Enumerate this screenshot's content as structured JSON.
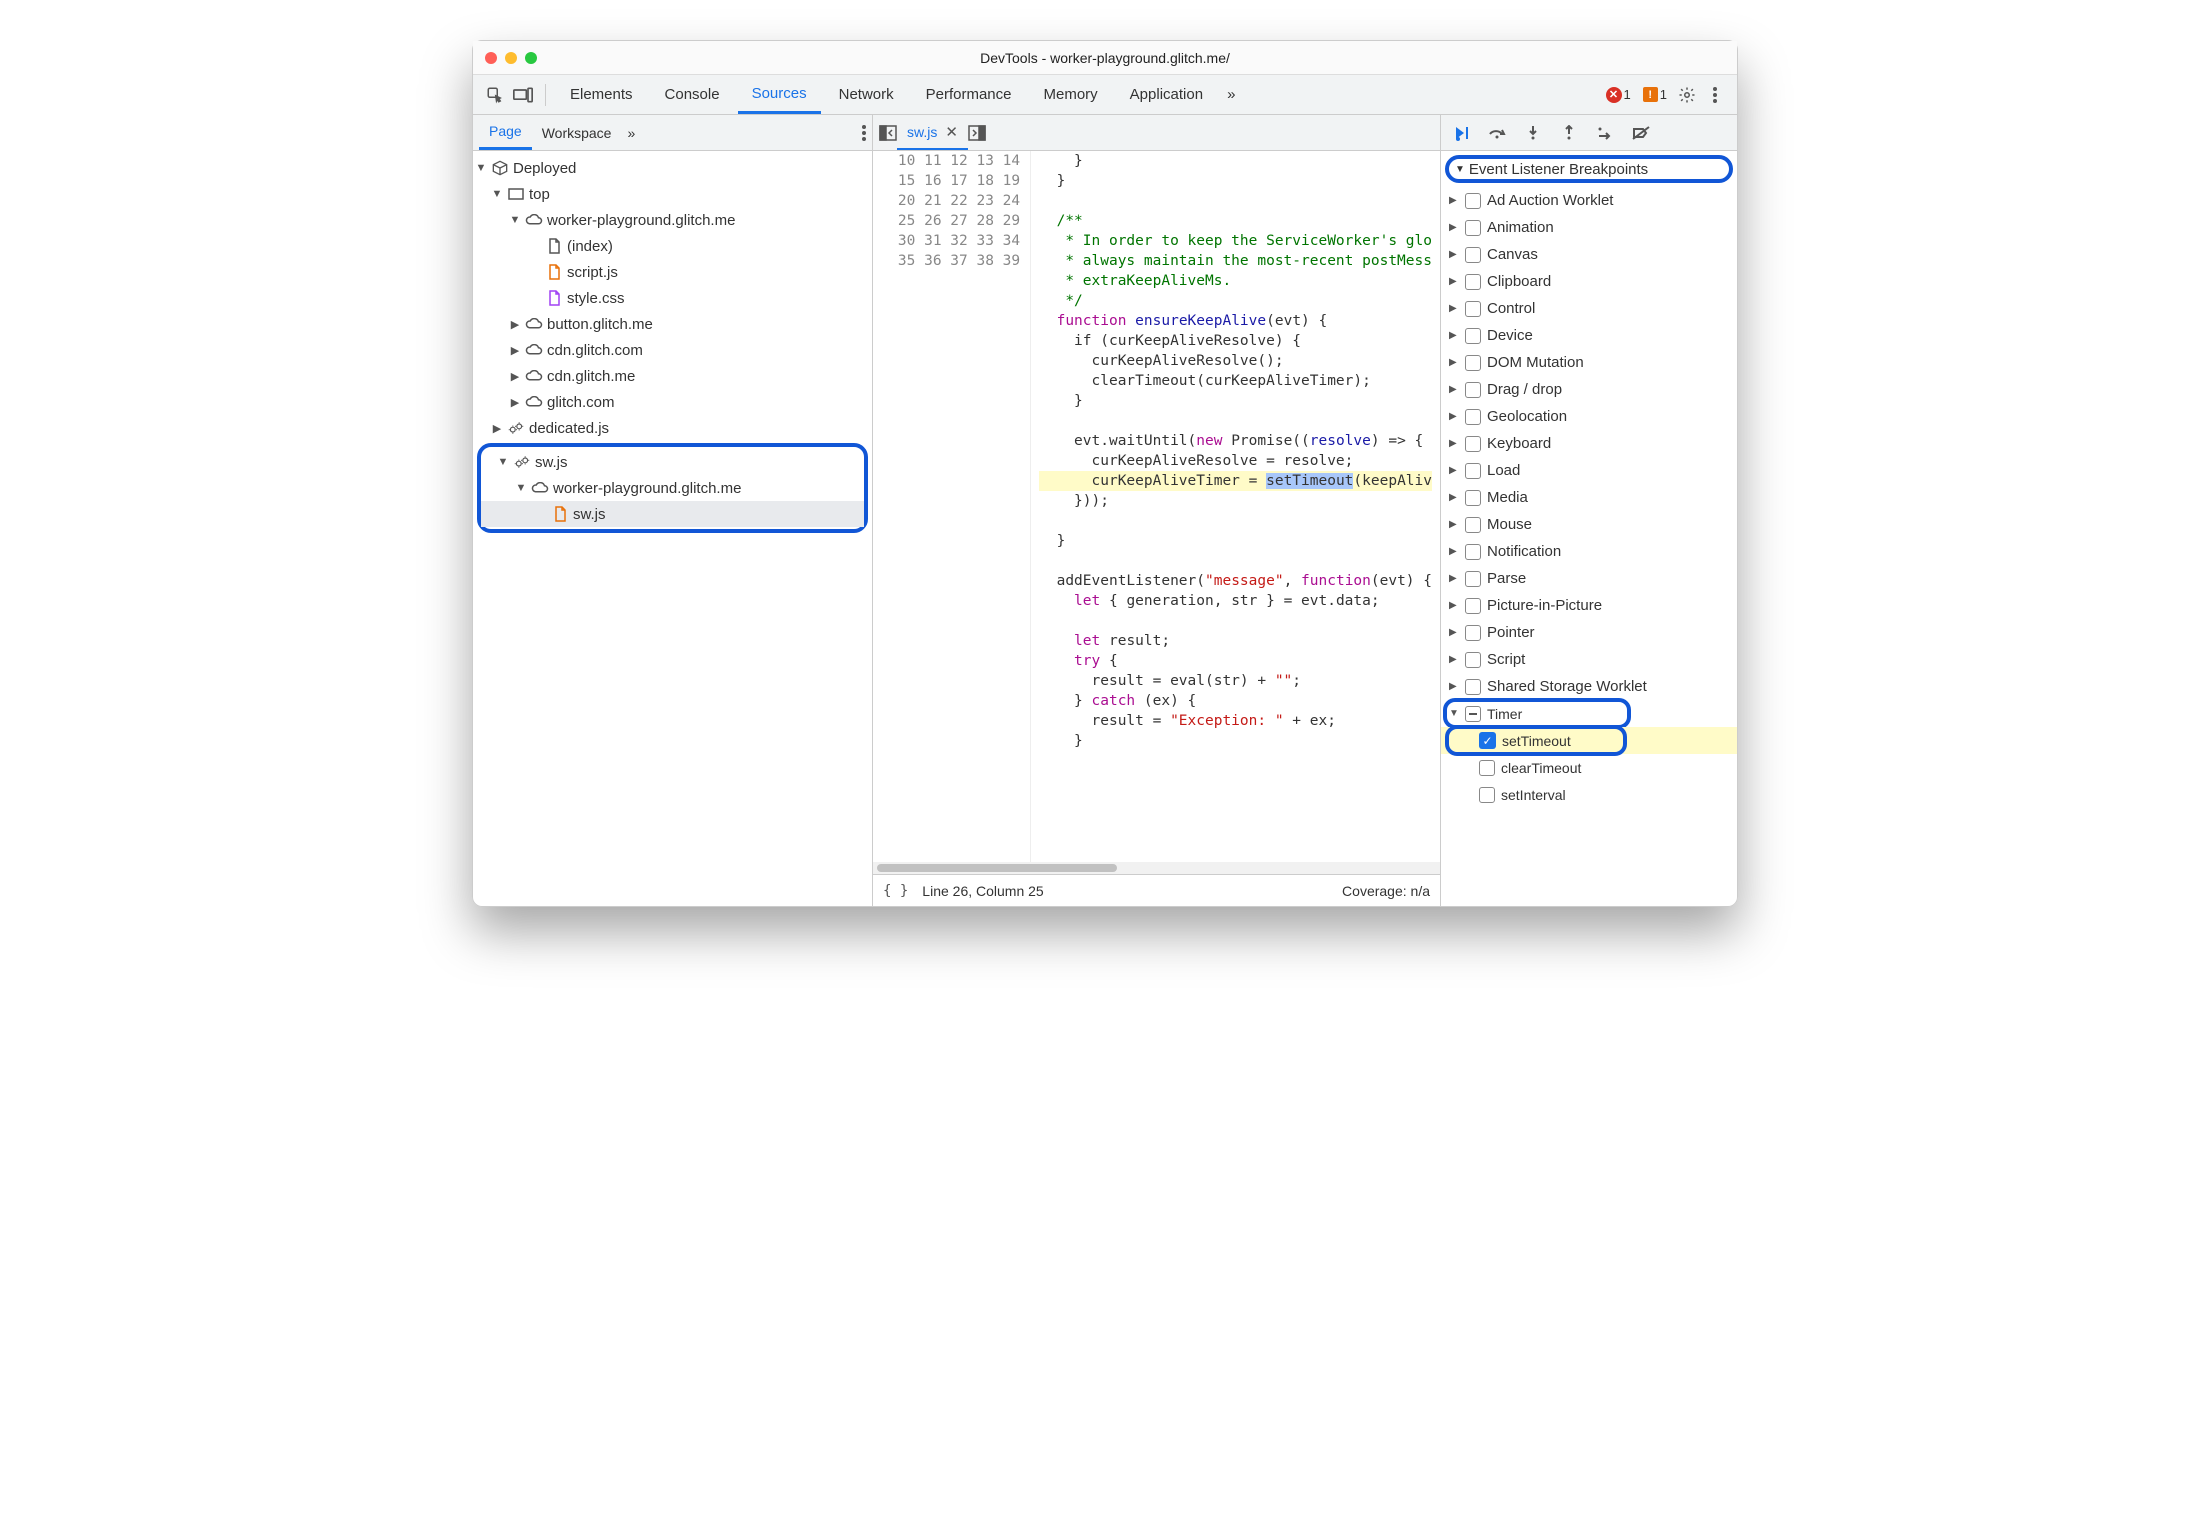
{
  "window": {
    "title": "DevTools - worker-playground.glitch.me/"
  },
  "mainTabs": {
    "items": [
      "Elements",
      "Console",
      "Sources",
      "Network",
      "Performance",
      "Memory",
      "Application"
    ],
    "overflow": "»",
    "errorCount": "1",
    "warnCount": "1"
  },
  "navigator": {
    "tabs": {
      "page": "Page",
      "workspace": "Workspace",
      "overflow": "»"
    },
    "tree": {
      "deployed": "Deployed",
      "top": "top",
      "topDomain": "worker-playground.glitch.me",
      "index": "(index)",
      "scriptjs": "script.js",
      "stylecss": "style.css",
      "button": "button.glitch.me",
      "cdn1": "cdn.glitch.com",
      "cdn2": "cdn.glitch.me",
      "glitchcom": "glitch.com",
      "dedicated": "dedicated.js",
      "swjs": "sw.js",
      "swDomain": "worker-playground.glitch.me",
      "swFile": "sw.js"
    }
  },
  "editor": {
    "filename": "sw.js",
    "lines": {
      "start": 10,
      "end": 39,
      "10": "    }",
      "11": "  }",
      "12": "",
      "13": "  /**",
      "14": "   * In order to keep the ServiceWorker's glo",
      "15": "   * always maintain the most-recent postMess",
      "16": "   * extraKeepAliveMs.",
      "17": "   */",
      "18_pre": "  ",
      "18_kw": "function",
      "18_sp": " ",
      "18_fn": "ensureKeepAlive",
      "18_post": "(evt) {",
      "19": "    if (curKeepAliveResolve) {",
      "20": "      curKeepAliveResolve();",
      "21": "      clearTimeout(curKeepAliveTimer);",
      "22": "    }",
      "23": "",
      "24_a": "    evt.waitUntil(",
      "24_kw": "new",
      "24_b": " Promise((",
      "24_fn": "resolve",
      "24_c": ") => {",
      "25": "      curKeepAliveResolve = resolve;",
      "26_a": "      curKeepAliveTimer = ",
      "26_sel": "setTimeout",
      "26_b": "(keepAliv",
      "27": "    }));",
      "28": "",
      "29": "  }",
      "30": "",
      "31_a": "  addEventListener(",
      "31_s": "\"message\"",
      "31_b": ", ",
      "31_kw": "function",
      "31_c": "(evt) {",
      "32_a": "    ",
      "32_kw": "let",
      "32_b": " { generation, str } = evt.data;",
      "33": "",
      "34_a": "    ",
      "34_kw": "let",
      "34_b": " result;",
      "35_a": "    ",
      "35_kw": "try",
      "35_b": " {",
      "36_a": "      result = eval(str) + ",
      "36_s": "\"\"",
      "36_b": ";",
      "37_a": "    } ",
      "37_kw": "catch",
      "37_b": " (ex) {",
      "38_a": "      result = ",
      "38_s": "\"Exception: \"",
      "38_b": " + ex;",
      "39": "    }"
    },
    "status": {
      "cursor": "Line 26, Column 25",
      "coverage": "Coverage: n/a"
    }
  },
  "debugger": {
    "section": "Event Listener Breakpoints",
    "cats": [
      "Ad Auction Worklet",
      "Animation",
      "Canvas",
      "Clipboard",
      "Control",
      "Device",
      "DOM Mutation",
      "Drag / drop",
      "Geolocation",
      "Keyboard",
      "Load",
      "Media",
      "Mouse",
      "Notification",
      "Parse",
      "Picture-in-Picture",
      "Pointer",
      "Script",
      "Shared Storage Worklet"
    ],
    "timer": {
      "label": "Timer",
      "setTimeout": "setTimeout",
      "clearTimeout": "clearTimeout",
      "setInterval": "setInterval"
    }
  }
}
